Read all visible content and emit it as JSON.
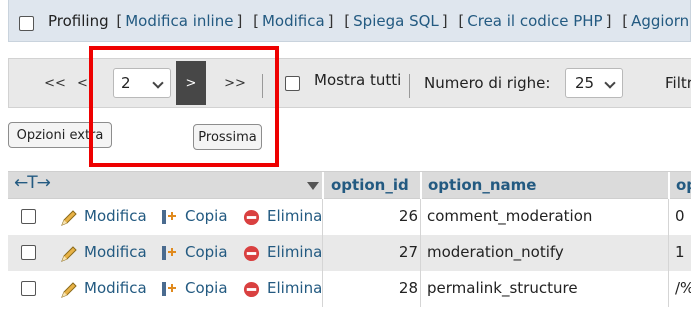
{
  "profiling": {
    "label": "Profiling",
    "links": [
      "Modifica inline",
      "Modifica",
      "Spiega SQL",
      "Crea il codice PHP",
      "Aggiorna"
    ]
  },
  "navigation": {
    "first": "<<",
    "prev": "<",
    "page_value": "2",
    "next": ">",
    "last": ">>",
    "show_all_label": "Mostra tutti",
    "rows_label": "Numero di righe:",
    "rows_value": "25",
    "filter_label": "Filtra"
  },
  "buttons": {
    "extra_options": "Opzioni extra",
    "next_page": "Prossima"
  },
  "table": {
    "headers": {
      "option_id": "option_id",
      "option_name": "option_name",
      "extra": "op"
    },
    "actions": {
      "edit": "Modifica",
      "copy": "Copia",
      "delete": "Elimina"
    },
    "rows": [
      {
        "option_id": "26",
        "option_name": "comment_moderation",
        "extra": "0"
      },
      {
        "option_id": "27",
        "option_name": "moderation_notify",
        "extra": "1"
      },
      {
        "option_id": "28",
        "option_name": "permalink_structure",
        "extra": "/%"
      }
    ]
  },
  "highlight": {
    "color": "#ee0000"
  },
  "colors": {
    "link": "#235a81",
    "next_active": "#474747"
  },
  "icons": [
    "checkbox-icon",
    "pencil-icon",
    "copy-icon",
    "delete-icon",
    "sort-arrow-icon",
    "column-arrows-icon",
    "chevron-down-icon"
  ]
}
